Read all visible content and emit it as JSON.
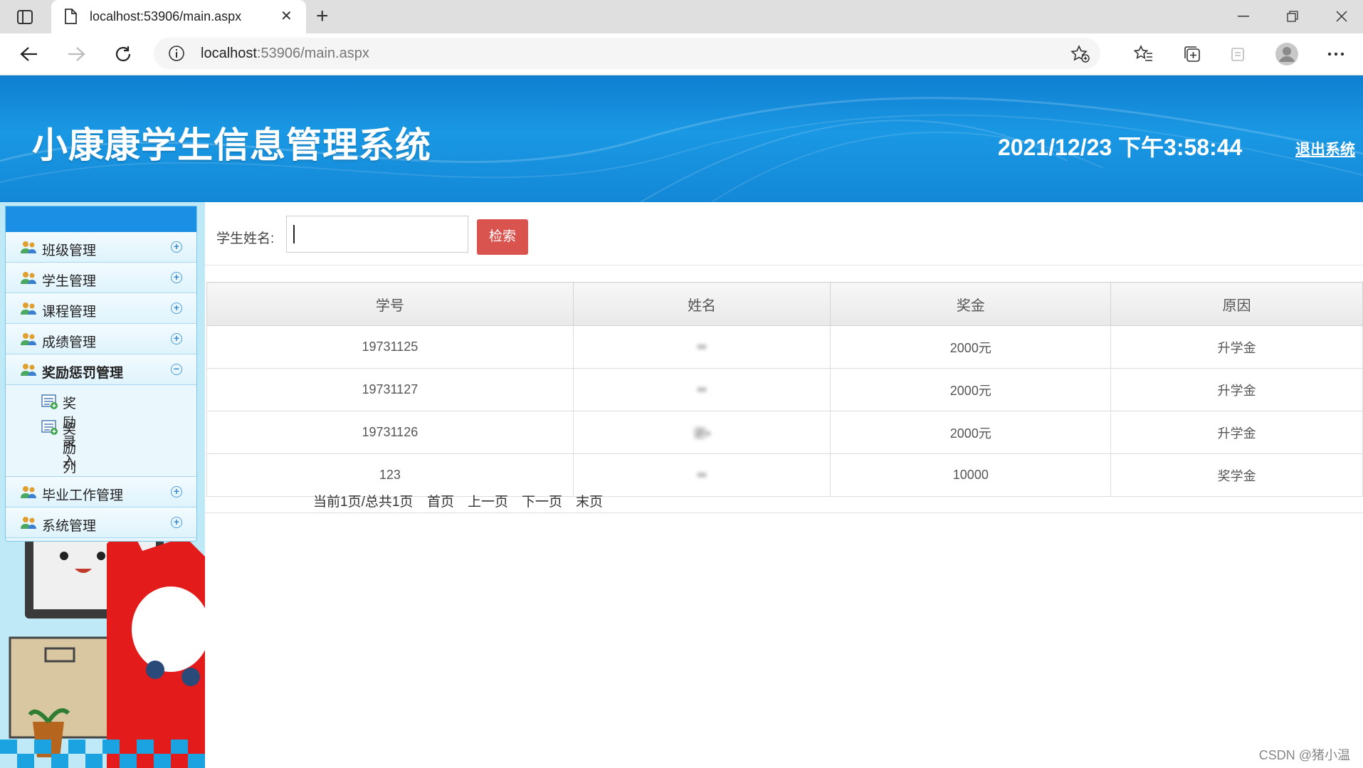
{
  "browser": {
    "tab_title": "localhost:53906/main.aspx",
    "url_host": "localhost",
    "url_rest": ":53906/main.aspx"
  },
  "header": {
    "title": "小康康学生信息管理系统",
    "datetime": "2021/12/23 下午3:58:44",
    "logout": "退出系统"
  },
  "menu": {
    "items": [
      {
        "label": "班级管理",
        "toggle": "+"
      },
      {
        "label": "学生管理",
        "toggle": "+"
      },
      {
        "label": "课程管理",
        "toggle": "+"
      },
      {
        "label": "成绩管理",
        "toggle": "+"
      },
      {
        "label": "奖励惩罚管理",
        "toggle": "−",
        "sub": [
          "奖励录入",
          "奖励列表"
        ]
      },
      {
        "label": "毕业工作管理",
        "toggle": "+"
      },
      {
        "label": "系统管理",
        "toggle": "+"
      }
    ]
  },
  "search": {
    "label": "学生姓名:",
    "value": "",
    "button": "检索"
  },
  "table": {
    "headers": [
      "学号",
      "姓名",
      "奖金",
      "原因"
    ],
    "rows": [
      [
        "19731125",
        "▪▪",
        "2000元",
        "升学金"
      ],
      [
        "19731127",
        "▪▪",
        "2000元",
        "升学金"
      ],
      [
        "19731126",
        "谢▪",
        "2000元",
        "升学金"
      ],
      [
        "123",
        "▪▪",
        "10000",
        "奖学金"
      ]
    ]
  },
  "pager": {
    "status": "当前1页/总共1页",
    "first": "首页",
    "prev": "上一页",
    "next": "下一页",
    "last": "末页"
  },
  "watermark": "CSDN @猪小温",
  "colors": {
    "header_blue": "#1a98e4",
    "search_button": "#d9534f",
    "menu_top": "#1b8fe3"
  }
}
